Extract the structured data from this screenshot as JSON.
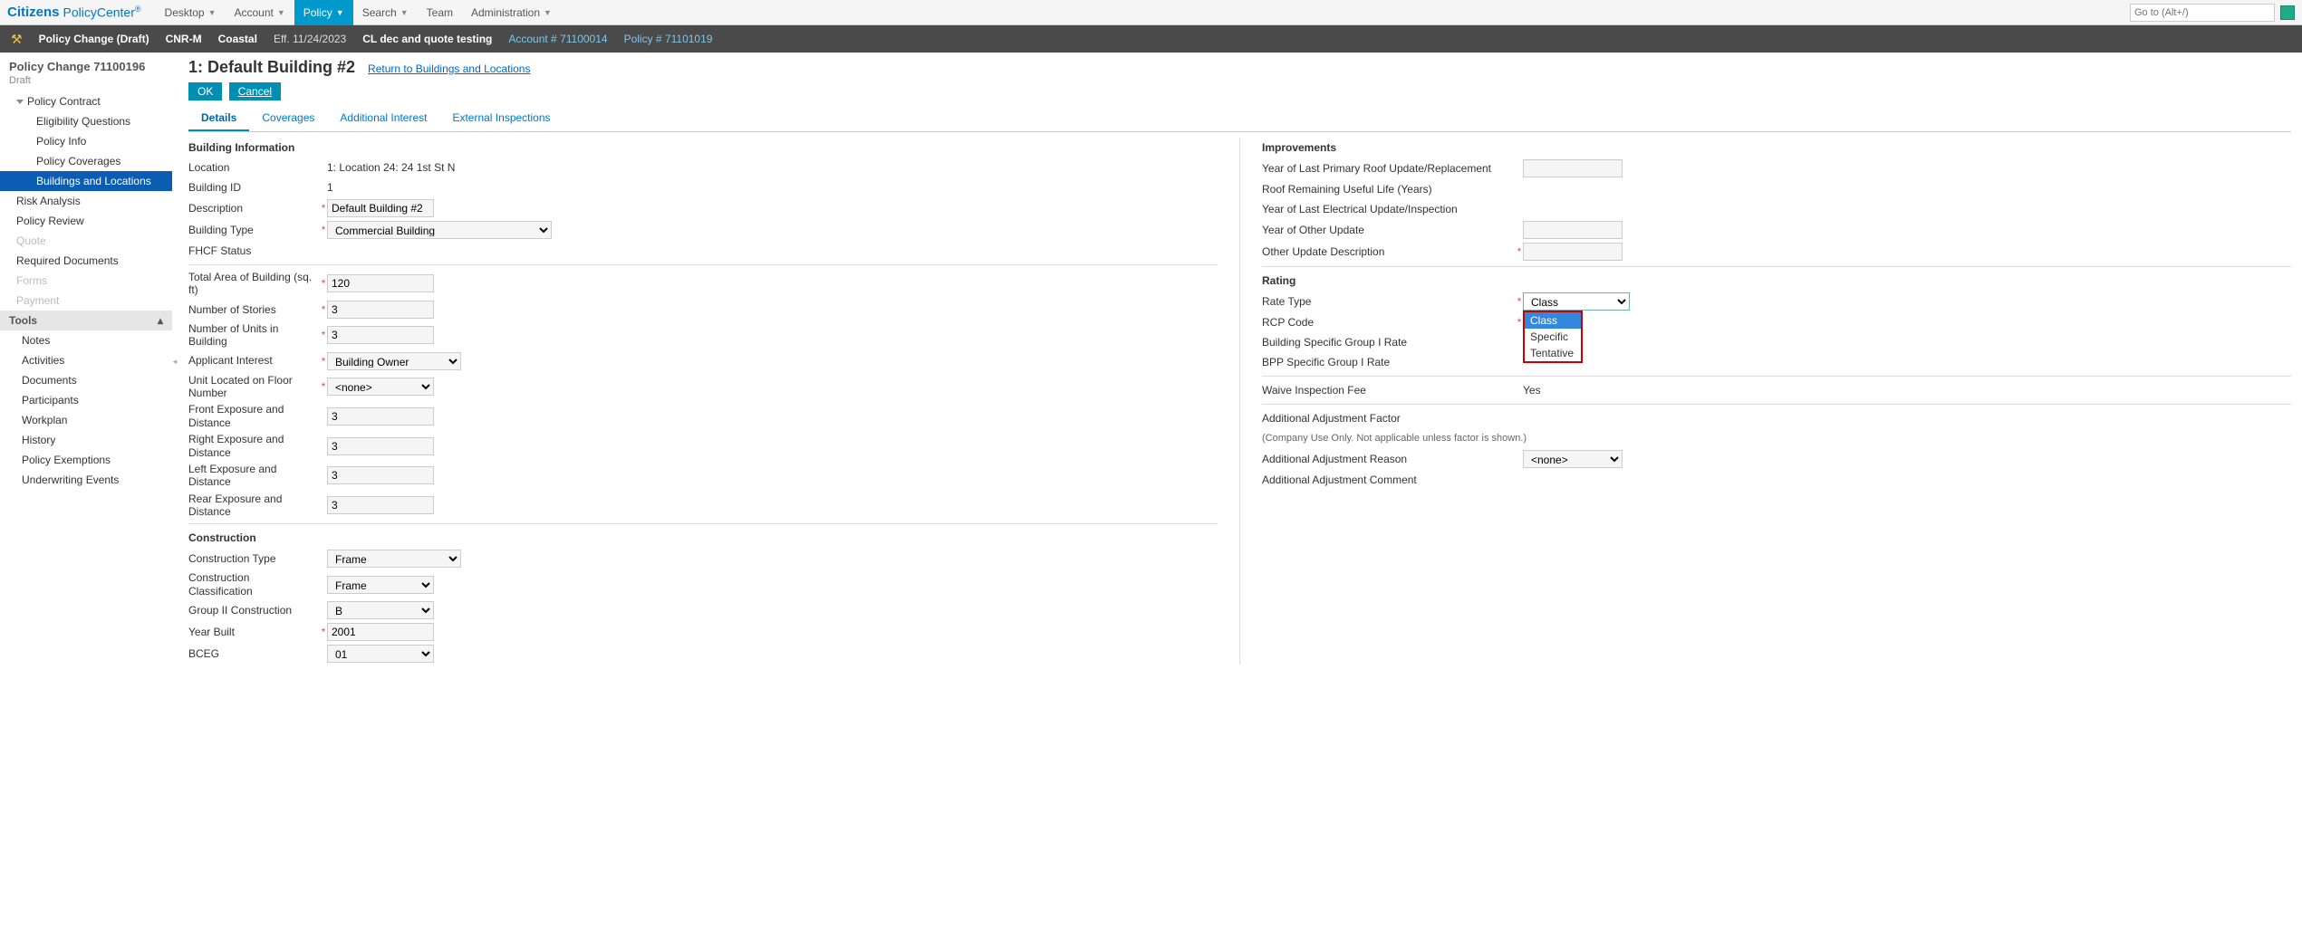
{
  "topmenu": {
    "brand": "Citizens",
    "brand_sub": "PolicyCenter",
    "items": [
      "Desktop",
      "Account",
      "Policy",
      "Search",
      "Team",
      "Administration"
    ],
    "goto_placeholder": "Go to (Alt+/)"
  },
  "contextbar": {
    "title": "Policy Change (Draft)",
    "segments": [
      "CNR-M",
      "Coastal",
      "Eff. 11/24/2023",
      "CL dec and quote testing"
    ],
    "account_label": "Account #",
    "account_num": "71100014",
    "policy_label": "Policy #",
    "policy_num": "71101019"
  },
  "sidebar": {
    "title": "Policy Change 71100196",
    "status": "Draft",
    "tree": {
      "policy_contract": "Policy Contract",
      "eligibility": "Eligibility Questions",
      "policy_info": "Policy Info",
      "policy_coverages": "Policy Coverages",
      "buildings": "Buildings and Locations",
      "risk": "Risk Analysis",
      "review": "Policy Review",
      "quote": "Quote",
      "required_docs": "Required Documents",
      "forms": "Forms",
      "payment": "Payment"
    },
    "tools_header": "Tools",
    "tools": [
      "Notes",
      "Activities",
      "Documents",
      "Participants",
      "Workplan",
      "History",
      "Policy Exemptions",
      "Underwriting Events"
    ]
  },
  "page": {
    "title": "1: Default Building #2",
    "return_link": "Return to Buildings and Locations",
    "ok": "OK",
    "cancel": "Cancel",
    "tabs": [
      "Details",
      "Coverages",
      "Additional Interest",
      "External Inspections"
    ]
  },
  "building_info": {
    "heading": "Building Information",
    "location_label": "Location",
    "location": "1: Location 24: 24 1st St N",
    "building_id_label": "Building ID",
    "building_id": "1",
    "description_label": "Description",
    "description": "Default Building #2",
    "building_type_label": "Building Type",
    "building_type": "Commercial Building",
    "fhcf_label": "FHCF Status",
    "total_area_label": "Total Area of Building (sq. ft)",
    "total_area": "120",
    "stories_label": "Number of Stories",
    "stories": "3",
    "units_label": "Number of Units in Building",
    "units": "3",
    "applicant_label": "Applicant Interest",
    "applicant": "Building Owner",
    "unit_floor_label": "Unit Located on Floor Number",
    "unit_floor_placeholder": "<none>",
    "front_label": "Front Exposure and Distance",
    "front": "3",
    "right_label": "Right Exposure and Distance",
    "right": "3",
    "left_label": "Left Exposure and Distance",
    "left": "3",
    "rear_label": "Rear Exposure and Distance",
    "rear": "3"
  },
  "construction": {
    "heading": "Construction",
    "type_label": "Construction Type",
    "type": "Frame",
    "class_label": "Construction Classification",
    "class": "Frame",
    "group2_label": "Group II Construction",
    "group2": "B",
    "year_label": "Year Built",
    "year": "2001",
    "bceg_label": "BCEG",
    "bceg": "01"
  },
  "improvements": {
    "heading": "Improvements",
    "roof_year_label": "Year of Last Primary Roof Update/Replacement",
    "roof_life_label": "Roof Remaining Useful Life (Years)",
    "electrical_label": "Year of Last Electrical Update/Inspection",
    "other_year_label": "Year of Other Update",
    "other_desc_label": "Other Update Description"
  },
  "rating": {
    "heading": "Rating",
    "rate_type_label": "Rate Type",
    "rate_type_value": "Class",
    "rate_type_options": [
      "Class",
      "Specific",
      "Tentative"
    ],
    "rcp_label": "RCP Code",
    "bsg_label": "Building Specific Group I Rate",
    "bpp_label": "BPP Specific Group I Rate",
    "waive_label": "Waive Inspection Fee",
    "waive_value": "Yes",
    "adj_factor_label": "Additional Adjustment Factor",
    "adj_factor_note": "(Company Use Only. Not applicable unless factor is shown.)",
    "adj_reason_label": "Additional Adjustment Reason",
    "adj_reason_placeholder": "<none>",
    "adj_comment_label": "Additional Adjustment Comment"
  }
}
